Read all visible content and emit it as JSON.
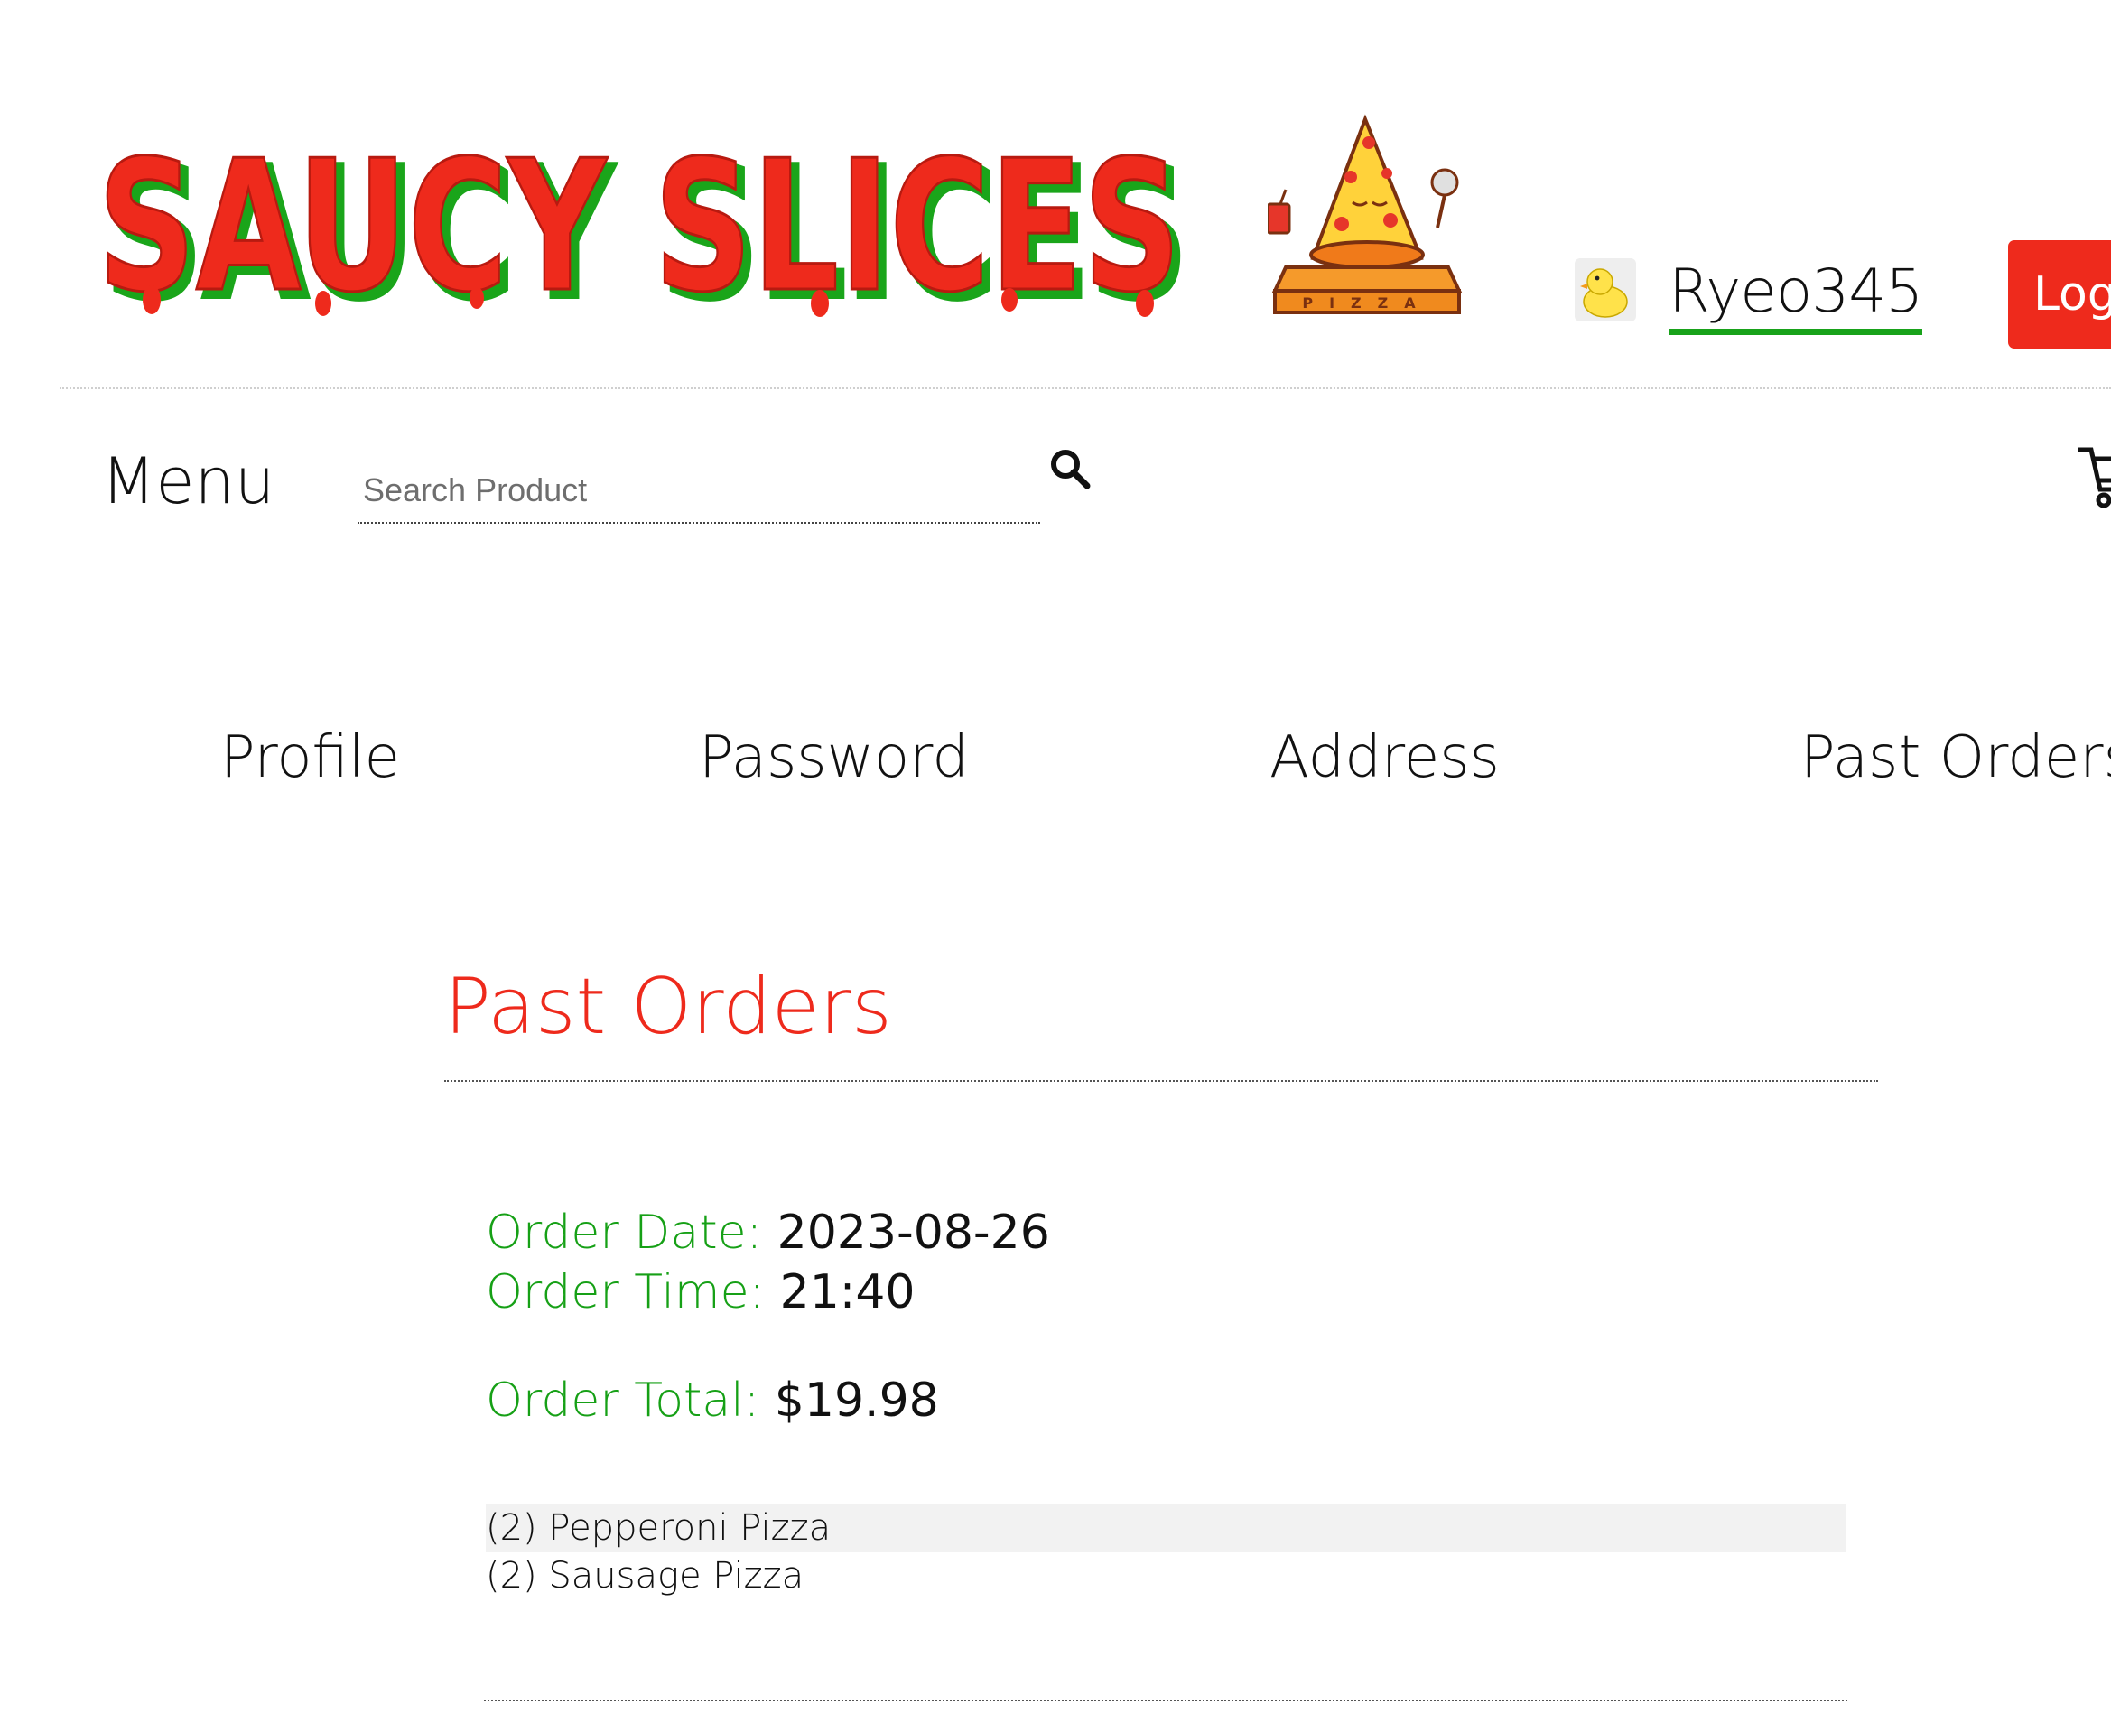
{
  "brand": {
    "logo_text": "SAUCY SLICES",
    "mascot_label": "PIZZA",
    "colors": {
      "logo_red": "#ee2a1c",
      "logo_green": "#1aa51a",
      "accent_green": "#16a016",
      "title_red": "#ee2a1c"
    }
  },
  "user": {
    "avatar_icon": "duck-icon",
    "username": "Ryeo345",
    "logout_label": "Logout"
  },
  "toolbar": {
    "menu_label": "Menu",
    "search_placeholder": "Search Product",
    "search_icon": "search-icon",
    "cart_icon": "cart-icon"
  },
  "tabs": [
    {
      "label": "Profile"
    },
    {
      "label": "Password"
    },
    {
      "label": "Address"
    },
    {
      "label": "Past Orders"
    }
  ],
  "main": {
    "title": "Past Orders",
    "order": {
      "date_label": "Order Date:",
      "date_value": "2023-08-26",
      "time_label": "Order Time:",
      "time_value": "21:40",
      "total_label": "Order Total:",
      "total_value": "$19.98",
      "items": [
        "(2) Pepperoni Pizza",
        "(2) Sausage Pizza"
      ]
    }
  }
}
